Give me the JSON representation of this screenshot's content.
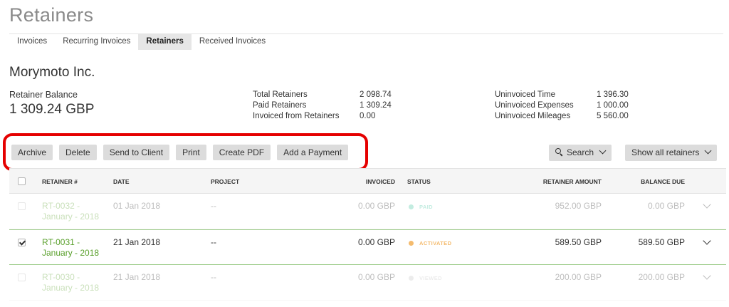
{
  "page": {
    "title": "Retainers"
  },
  "tabs": [
    {
      "label": "Invoices",
      "active": false
    },
    {
      "label": "Recurring Invoices",
      "active": false
    },
    {
      "label": "Retainers",
      "active": true
    },
    {
      "label": "Received Invoices",
      "active": false
    }
  ],
  "client": {
    "name": "Morymoto Inc."
  },
  "balance": {
    "label": "Retainer Balance",
    "value": "1 309.24 GBP"
  },
  "summary_mid": [
    {
      "label": "Total Retainers",
      "value": "2 098.74"
    },
    {
      "label": "Paid Retainers",
      "value": "1 309.24"
    },
    {
      "label": "Invoiced from Retainers",
      "value": "0.00"
    }
  ],
  "summary_right": [
    {
      "label": "Uninvoiced Time",
      "value": "1 396.30"
    },
    {
      "label": "Uninvoiced Expenses",
      "value": "1 000.00"
    },
    {
      "label": "Uninvoiced Mileages",
      "value": "5 560.00"
    }
  ],
  "toolbar": {
    "archive": "Archive",
    "delete": "Delete",
    "send": "Send to Client",
    "print": "Print",
    "pdf": "Create PDF",
    "payment": "Add a Payment",
    "search": "Search",
    "filter": "Show all retainers"
  },
  "table": {
    "headers": {
      "retainer": "RETAINER #",
      "date": "DATE",
      "project": "PROJECT",
      "invoiced": "INVOICED",
      "status": "STATUS",
      "amount": "RETAINER AMOUNT",
      "balance": "BALANCE DUE"
    },
    "rows": [
      {
        "id_line1": "RT-0032 -",
        "id_line2": "January - 2018",
        "date": "01 Jan 2018",
        "project": "--",
        "invoiced": "0.00 GBP",
        "status": "PAID",
        "status_color": "#46c6a2",
        "amount": "952.00 GBP",
        "balance": "0.00 GBP",
        "checked": false
      },
      {
        "id_line1": "RT-0031 -",
        "id_line2": "January - 2018",
        "date": "21 Jan 2018",
        "project": "--",
        "invoiced": "0.00 GBP",
        "status": "ACTIVATED",
        "status_color": "#f4bb6e",
        "amount": "589.50 GBP",
        "balance": "589.50 GBP",
        "checked": true
      },
      {
        "id_line1": "RT-0030 -",
        "id_line2": "January - 2018",
        "date": "21 Jan 2018",
        "project": "--",
        "invoiced": "0.00 GBP",
        "status": "VIEWED",
        "status_color": "#c7c7c7",
        "amount": "200.00 GBP",
        "balance": "200.00 GBP",
        "checked": false
      }
    ]
  },
  "colors": {
    "link": "#5aa02c",
    "highlight": "#e50000",
    "button": "#dcdcdc",
    "selected_border": "#9ccb88"
  }
}
